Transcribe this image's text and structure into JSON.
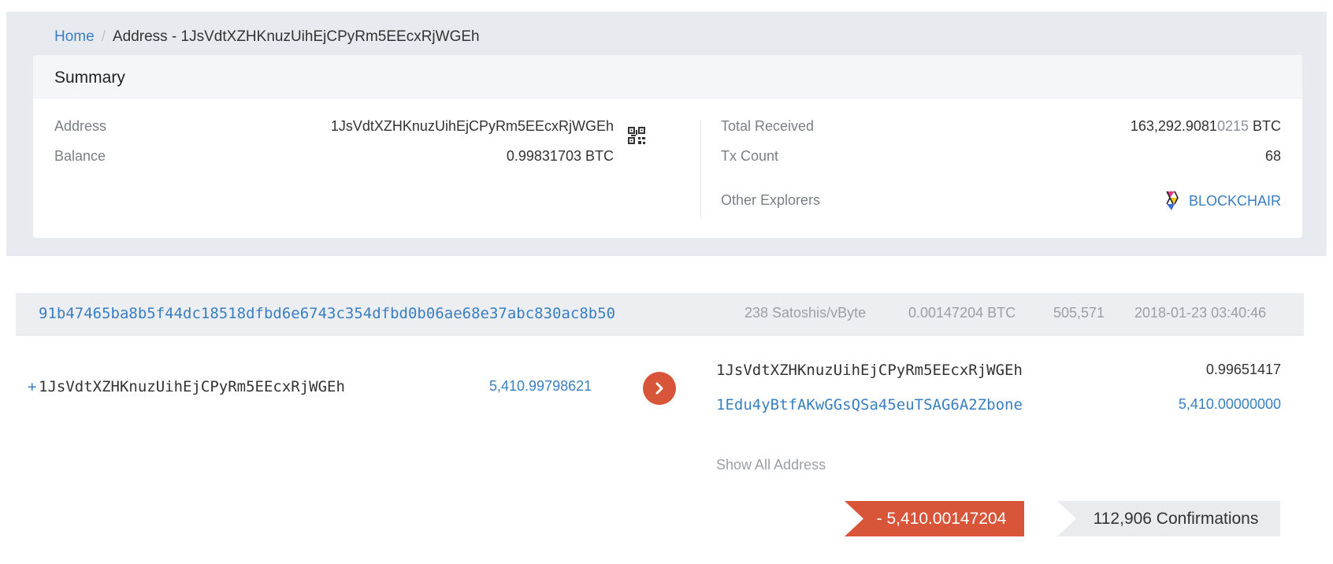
{
  "breadcrumb": {
    "home": "Home",
    "separator": "/",
    "current": "Address - 1JsVdtXZHKnuzUihEjCPyRm5EEcxRjWGEh"
  },
  "summary": {
    "title": "Summary",
    "address_label": "Address",
    "address_value": "1JsVdtXZHKnuzUihEjCPyRm5EEcxRjWGEh",
    "balance_label": "Balance",
    "balance_main": "0.99831703",
    "balance_unit": "BTC",
    "total_received_label": "Total Received",
    "total_received_main": "163,292.9081",
    "total_received_dim": "0215",
    "total_received_unit": "BTC",
    "tx_count_label": "Tx Count",
    "tx_count_value": "68",
    "other_explorers_label": "Other Explorers",
    "explorer_link": "BLOCKCHAIR",
    "icons": {
      "qr": "qr-code-icon",
      "explorer": "blockchair-logo-icon"
    }
  },
  "transaction": {
    "hash": "91b47465ba8b5f44dc18518dfbd6e6743c354dfbd0b06ae68e37abc830ac8b50",
    "fee_rate": "238 Satoshis/vByte",
    "fee": "0.00147204 BTC",
    "block_height": "505,571",
    "timestamp": "2018-01-23 03:40:46",
    "input": {
      "prefix": "+",
      "address": "1JsVdtXZHKnuzUihEjCPyRm5EEcxRjWGEh",
      "amount": "5,410.99798621"
    },
    "outputs": [
      {
        "address": "1JsVdtXZHKnuzUihEjCPyRm5EEcxRjWGEh",
        "amount": "0.99651417"
      },
      {
        "address": "1Edu4yBtfAKwGGsQSa45euTSAG6A2Zbone",
        "amount": "5,410.00000000"
      }
    ],
    "show_all": "Show All Address",
    "net_change": "- 5,410.00147204",
    "confirmations": "112,906 Confirmations"
  },
  "colors": {
    "accent": "#d9553a",
    "link": "#3a7fc1",
    "band": "#e7eaef"
  }
}
